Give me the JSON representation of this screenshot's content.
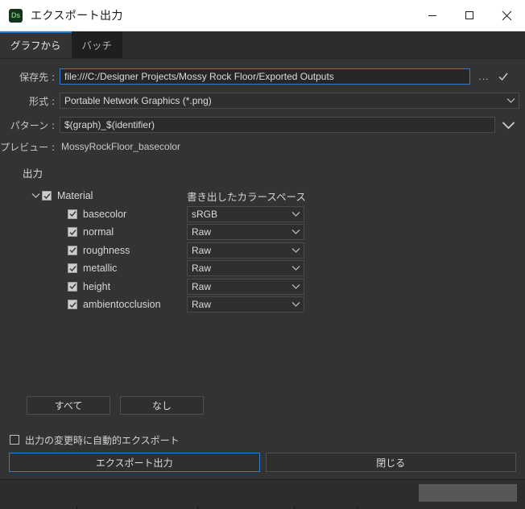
{
  "window": {
    "app_icon_text": "Ds",
    "title": "エクスポート出力",
    "minimize_label": "minimize",
    "maximize_label": "maximize",
    "close_label": "close"
  },
  "tabs": [
    {
      "label": "グラフから",
      "active": true
    },
    {
      "label": "バッチ",
      "active": false
    }
  ],
  "form": {
    "destination": {
      "label": "保存先 :",
      "value": "file:///C:/Designer Projects/Mossy Rock Floor/Exported Outputs",
      "placeholder": "file:///",
      "browse_label": "...",
      "confirm_icon": "check-icon"
    },
    "format": {
      "label": "形式 :",
      "value": "Portable Network Graphics (*.png)"
    },
    "pattern": {
      "label": "パターン :",
      "value": "$(graph)_$(identifier)",
      "placeholder": "$(graph)_$(identifier)"
    },
    "preview": {
      "label": "プレビュー :",
      "value": "MossyRockFloor_basecolor"
    }
  },
  "outputs": {
    "section_title": "出力",
    "colorspace_header": "書き出したカラースペース",
    "group": {
      "label": "Material",
      "checked": true,
      "expanded": true
    },
    "items": [
      {
        "label": "basecolor",
        "checked": true,
        "colorspace": "sRGB"
      },
      {
        "label": "normal",
        "checked": true,
        "colorspace": "Raw"
      },
      {
        "label": "roughness",
        "checked": true,
        "colorspace": "Raw"
      },
      {
        "label": "metallic",
        "checked": true,
        "colorspace": "Raw"
      },
      {
        "label": "height",
        "checked": true,
        "colorspace": "Raw"
      },
      {
        "label": "ambientocclusion",
        "checked": true,
        "colorspace": "Raw"
      }
    ]
  },
  "selection_buttons": {
    "all": "すべて",
    "none": "なし"
  },
  "auto_export": {
    "label": "出力の変更時に自動的エクスポート",
    "checked": false
  },
  "actions": {
    "export": "エクスポート出力",
    "close": "閉じる"
  },
  "colors": {
    "window_background": "#333333",
    "titlebar_background": "#ffffff",
    "accent_blue": "#2b7fd0",
    "tab_active_underline": "#1a7ad4",
    "field_background": "#2b2b2b",
    "app_icon_background": "#12351b",
    "app_icon_text": "#77c66a"
  }
}
